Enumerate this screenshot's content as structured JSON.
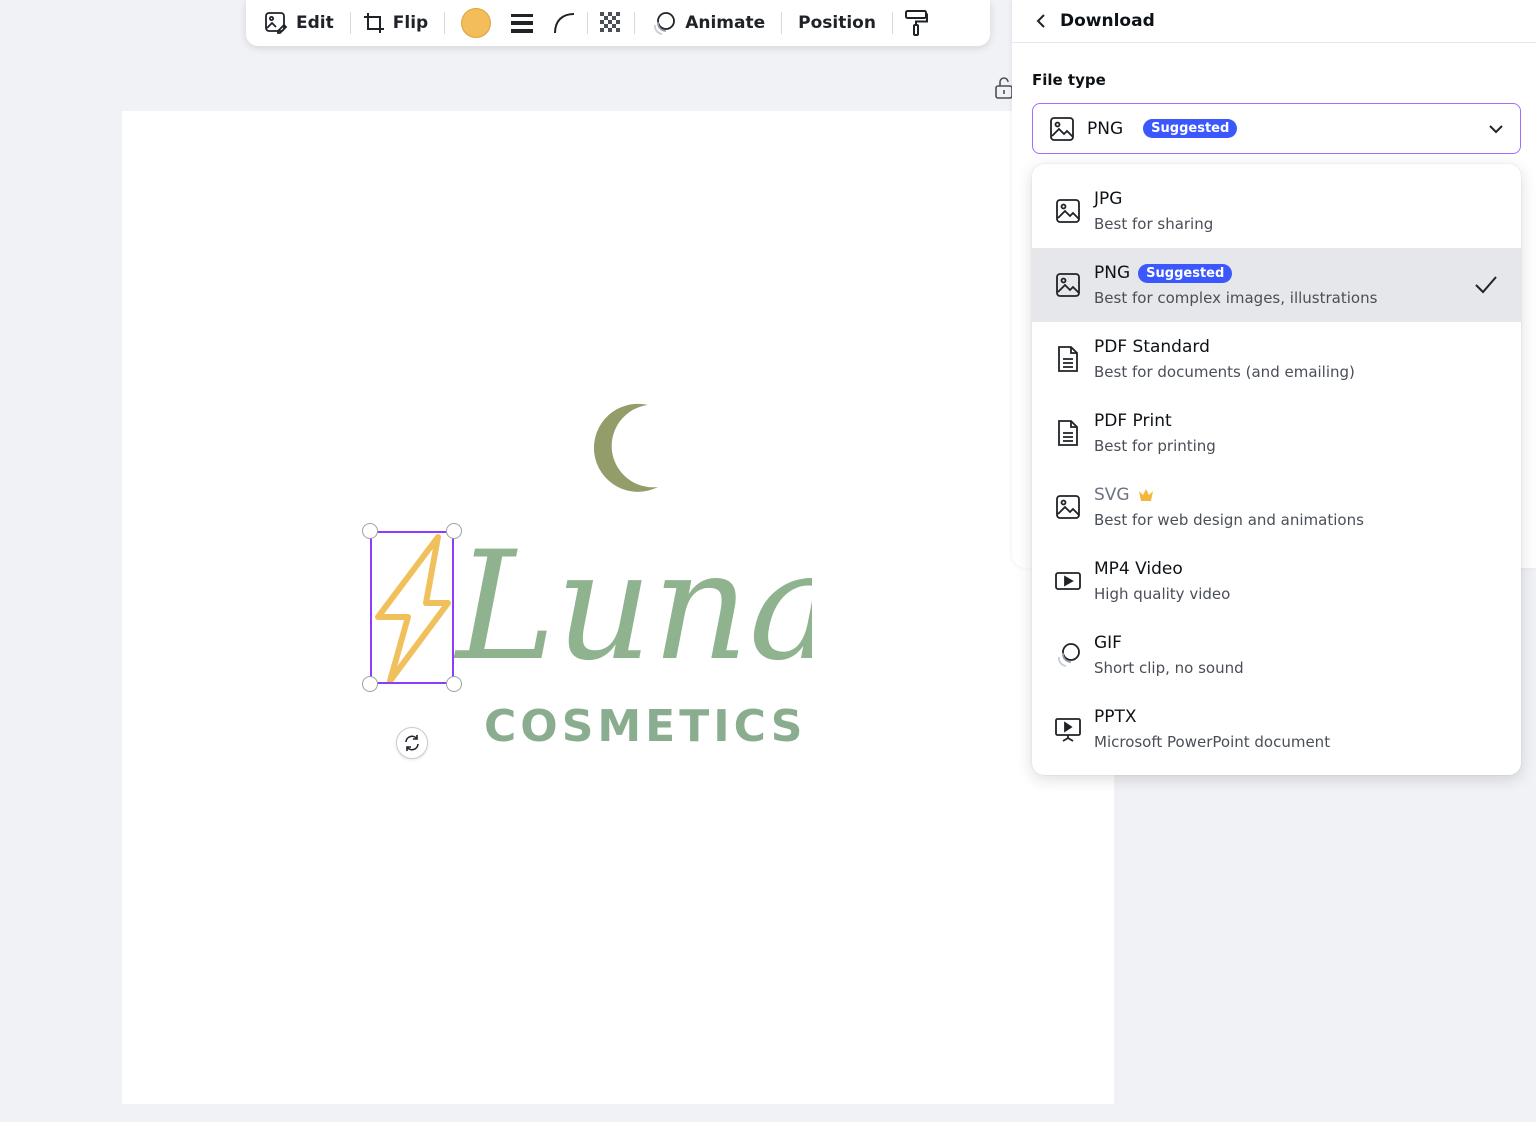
{
  "toolbar": {
    "edit_label": "Edit",
    "flip_label": "Flip",
    "animate_label": "Animate",
    "position_label": "Position",
    "color_swatch": "#f3be5a"
  },
  "canvas": {
    "brand_script": "Luna",
    "brand_sub": "COSMETICS",
    "colors": {
      "bolt": "#f0c05c",
      "moon": "#939d6a",
      "script": "#8fb28f",
      "sub": "#8aac8f",
      "selection": "#8b3dff"
    }
  },
  "panel": {
    "title": "Download",
    "file_type_label": "File type",
    "selected": {
      "name": "PNG",
      "badge": "Suggested"
    }
  },
  "options": [
    {
      "name": "JPG",
      "desc": "Best for sharing",
      "icon": "image-icon"
    },
    {
      "name": "PNG",
      "badge": "Suggested",
      "desc": "Best for complex images, illustrations",
      "icon": "image-icon",
      "selected": true
    },
    {
      "name": "PDF Standard",
      "desc": "Best for documents (and emailing)",
      "icon": "document-icon"
    },
    {
      "name": "PDF Print",
      "desc": "Best for printing",
      "icon": "document-icon"
    },
    {
      "name": "SVG",
      "desc": "Best for web design and animations",
      "icon": "image-icon",
      "pro": true
    },
    {
      "name": "MP4 Video",
      "desc": "High quality video",
      "icon": "video-icon"
    },
    {
      "name": "GIF",
      "desc": "Short clip, no sound",
      "icon": "gif-icon"
    },
    {
      "name": "PPTX",
      "desc": "Microsoft PowerPoint document",
      "icon": "presentation-icon"
    }
  ]
}
